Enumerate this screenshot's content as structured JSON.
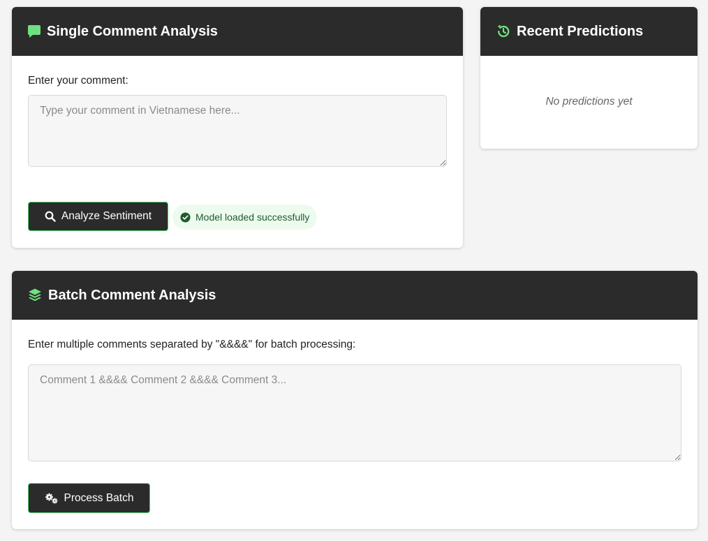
{
  "single": {
    "title": "Single Comment Analysis",
    "icon": "comment-icon",
    "input_label": "Enter your comment:",
    "input_value": "",
    "input_placeholder": "Type your comment in Vietnamese here...",
    "analyze_label": "Analyze Sentiment",
    "analyze_icon": "search-icon",
    "status_text": "Model loaded successfully",
    "status_icon": "check-circle-icon"
  },
  "recent": {
    "title": "Recent Predictions",
    "icon": "history-icon",
    "empty_text": "No predictions yet"
  },
  "batch": {
    "title": "Batch Comment Analysis",
    "icon": "layers-icon",
    "input_label": "Enter multiple comments separated by \"&&&&\" for batch processing:",
    "input_value": "",
    "input_placeholder": "Comment 1 &&&& Comment 2 &&&& Comment 3...",
    "process_label": "Process Batch",
    "process_icon": "cogs-icon"
  },
  "colors": {
    "header_bg": "#2b2b2b",
    "accent_green": "#4fd16a",
    "status_bg": "#edfbef",
    "status_text": "#1d5a2c",
    "page_bg": "#f4f4f4"
  }
}
